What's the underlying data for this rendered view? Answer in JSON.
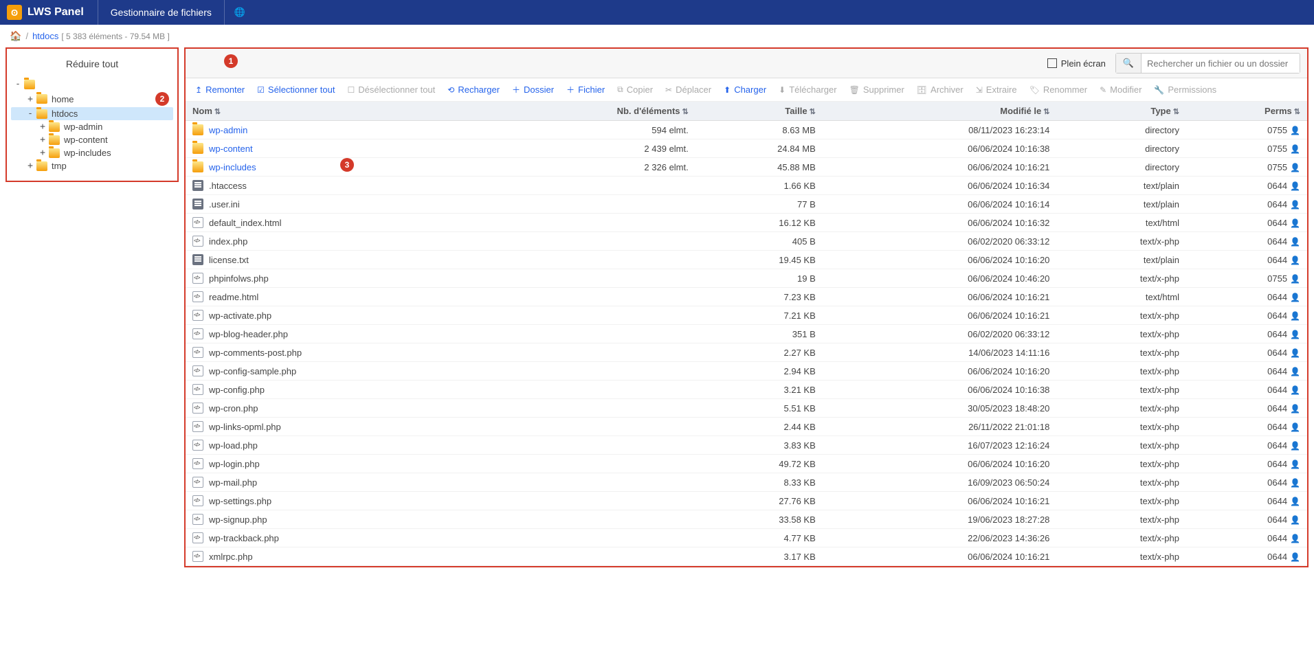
{
  "header": {
    "logo_text": "LWS Panel",
    "title": "Gestionnaire de fichiers"
  },
  "breadcrumb": {
    "current": "htdocs",
    "meta": "[ 5 383 éléments - 79.54 MB ]"
  },
  "sidebar": {
    "collapse_all": "Réduire tout",
    "tree": [
      {
        "label": "",
        "depth": 0,
        "exp": "-",
        "sel": false
      },
      {
        "label": "home",
        "depth": 1,
        "exp": "+",
        "sel": false
      },
      {
        "label": "htdocs",
        "depth": 1,
        "exp": "-",
        "sel": true
      },
      {
        "label": "wp-admin",
        "depth": 2,
        "exp": "+",
        "sel": false
      },
      {
        "label": "wp-content",
        "depth": 2,
        "exp": "+",
        "sel": false
      },
      {
        "label": "wp-includes",
        "depth": 2,
        "exp": "+",
        "sel": false
      },
      {
        "label": "tmp",
        "depth": 1,
        "exp": "+",
        "sel": false
      }
    ]
  },
  "badges": {
    "b1": "1",
    "b2": "2",
    "b3": "3"
  },
  "topbar": {
    "fullscreen": "Plein écran",
    "search_placeholder": "Rechercher un fichier ou un dossier"
  },
  "toolbar": {
    "remonter": "Remonter",
    "select_all": "Sélectionner tout",
    "deselect_all": "Désélectionner tout",
    "reload": "Recharger",
    "new_folder": "Dossier",
    "new_file": "Fichier",
    "copy": "Copier",
    "move": "Déplacer",
    "upload": "Charger",
    "download": "Télécharger",
    "delete": "Supprimer",
    "archive": "Archiver",
    "extract": "Extraire",
    "rename": "Renommer",
    "edit": "Modifier",
    "perms": "Permissions"
  },
  "columns": {
    "name": "Nom",
    "items": "Nb. d'éléments",
    "size": "Taille",
    "modified": "Modifié le",
    "type": "Type",
    "perms": "Perms"
  },
  "rows": [
    {
      "name": "wp-admin",
      "link": true,
      "kind": "dir",
      "items": "594 elmt.",
      "size": "8.63 MB",
      "mod": "08/11/2023 16:23:14",
      "type": "directory",
      "perms": "0755"
    },
    {
      "name": "wp-content",
      "link": true,
      "kind": "dir",
      "items": "2 439 elmt.",
      "size": "24.84 MB",
      "mod": "06/06/2024 10:16:38",
      "type": "directory",
      "perms": "0755"
    },
    {
      "name": "wp-includes",
      "link": true,
      "kind": "dir",
      "items": "2 326 elmt.",
      "size": "45.88 MB",
      "mod": "06/06/2024 10:16:21",
      "type": "directory",
      "perms": "0755"
    },
    {
      "name": ".htaccess",
      "link": false,
      "kind": "txt",
      "items": "",
      "size": "1.66 KB",
      "mod": "06/06/2024 10:16:34",
      "type": "text/plain",
      "perms": "0644"
    },
    {
      "name": ".user.ini",
      "link": false,
      "kind": "txt",
      "items": "",
      "size": "77 B",
      "mod": "06/06/2024 10:16:14",
      "type": "text/plain",
      "perms": "0644"
    },
    {
      "name": "default_index.html",
      "link": false,
      "kind": "cod",
      "items": "",
      "size": "16.12 KB",
      "mod": "06/06/2024 10:16:32",
      "type": "text/html",
      "perms": "0644"
    },
    {
      "name": "index.php",
      "link": false,
      "kind": "cod",
      "items": "",
      "size": "405 B",
      "mod": "06/02/2020 06:33:12",
      "type": "text/x-php",
      "perms": "0644"
    },
    {
      "name": "license.txt",
      "link": false,
      "kind": "txt",
      "items": "",
      "size": "19.45 KB",
      "mod": "06/06/2024 10:16:20",
      "type": "text/plain",
      "perms": "0644"
    },
    {
      "name": "phpinfolws.php",
      "link": false,
      "kind": "cod",
      "items": "",
      "size": "19 B",
      "mod": "06/06/2024 10:46:20",
      "type": "text/x-php",
      "perms": "0755"
    },
    {
      "name": "readme.html",
      "link": false,
      "kind": "cod",
      "items": "",
      "size": "7.23 KB",
      "mod": "06/06/2024 10:16:21",
      "type": "text/html",
      "perms": "0644"
    },
    {
      "name": "wp-activate.php",
      "link": false,
      "kind": "cod",
      "items": "",
      "size": "7.21 KB",
      "mod": "06/06/2024 10:16:21",
      "type": "text/x-php",
      "perms": "0644"
    },
    {
      "name": "wp-blog-header.php",
      "link": false,
      "kind": "cod",
      "items": "",
      "size": "351 B",
      "mod": "06/02/2020 06:33:12",
      "type": "text/x-php",
      "perms": "0644"
    },
    {
      "name": "wp-comments-post.php",
      "link": false,
      "kind": "cod",
      "items": "",
      "size": "2.27 KB",
      "mod": "14/06/2023 14:11:16",
      "type": "text/x-php",
      "perms": "0644"
    },
    {
      "name": "wp-config-sample.php",
      "link": false,
      "kind": "cod",
      "items": "",
      "size": "2.94 KB",
      "mod": "06/06/2024 10:16:20",
      "type": "text/x-php",
      "perms": "0644"
    },
    {
      "name": "wp-config.php",
      "link": false,
      "kind": "cod",
      "items": "",
      "size": "3.21 KB",
      "mod": "06/06/2024 10:16:38",
      "type": "text/x-php",
      "perms": "0644"
    },
    {
      "name": "wp-cron.php",
      "link": false,
      "kind": "cod",
      "items": "",
      "size": "5.51 KB",
      "mod": "30/05/2023 18:48:20",
      "type": "text/x-php",
      "perms": "0644"
    },
    {
      "name": "wp-links-opml.php",
      "link": false,
      "kind": "cod",
      "items": "",
      "size": "2.44 KB",
      "mod": "26/11/2022 21:01:18",
      "type": "text/x-php",
      "perms": "0644"
    },
    {
      "name": "wp-load.php",
      "link": false,
      "kind": "cod",
      "items": "",
      "size": "3.83 KB",
      "mod": "16/07/2023 12:16:24",
      "type": "text/x-php",
      "perms": "0644"
    },
    {
      "name": "wp-login.php",
      "link": false,
      "kind": "cod",
      "items": "",
      "size": "49.72 KB",
      "mod": "06/06/2024 10:16:20",
      "type": "text/x-php",
      "perms": "0644"
    },
    {
      "name": "wp-mail.php",
      "link": false,
      "kind": "cod",
      "items": "",
      "size": "8.33 KB",
      "mod": "16/09/2023 06:50:24",
      "type": "text/x-php",
      "perms": "0644"
    },
    {
      "name": "wp-settings.php",
      "link": false,
      "kind": "cod",
      "items": "",
      "size": "27.76 KB",
      "mod": "06/06/2024 10:16:21",
      "type": "text/x-php",
      "perms": "0644"
    },
    {
      "name": "wp-signup.php",
      "link": false,
      "kind": "cod",
      "items": "",
      "size": "33.58 KB",
      "mod": "19/06/2023 18:27:28",
      "type": "text/x-php",
      "perms": "0644"
    },
    {
      "name": "wp-trackback.php",
      "link": false,
      "kind": "cod",
      "items": "",
      "size": "4.77 KB",
      "mod": "22/06/2023 14:36:26",
      "type": "text/x-php",
      "perms": "0644"
    },
    {
      "name": "xmlrpc.php",
      "link": false,
      "kind": "cod",
      "items": "",
      "size": "3.17 KB",
      "mod": "06/06/2024 10:16:21",
      "type": "text/x-php",
      "perms": "0644"
    }
  ]
}
